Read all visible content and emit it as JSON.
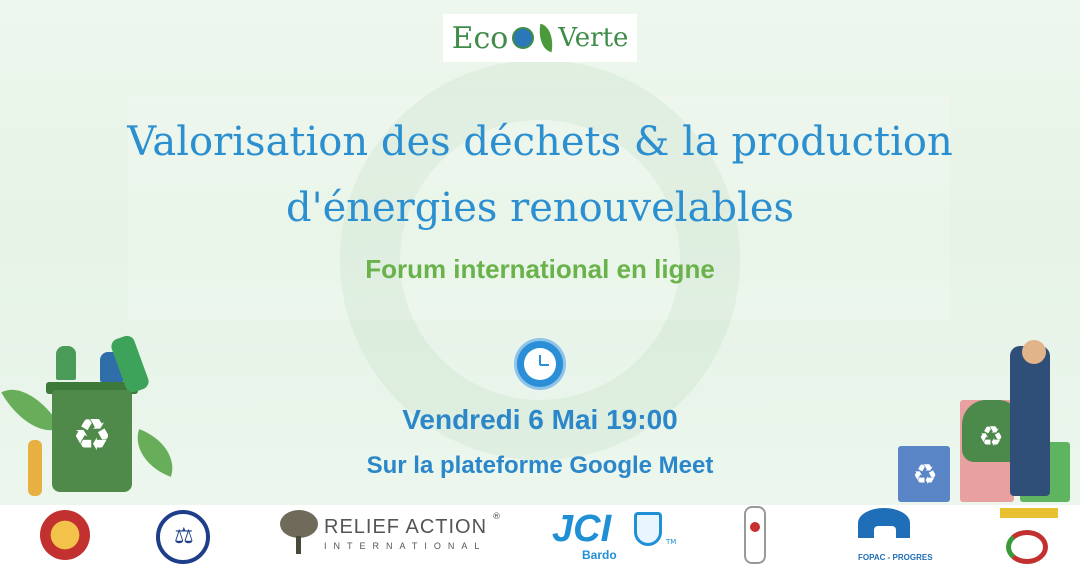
{
  "logo": {
    "brand_part1": "Eco",
    "brand_part2": "Verte",
    "icons": [
      "globe-icon",
      "leaf-icon"
    ]
  },
  "event": {
    "title_line1": "Valorisation des déchets & la production",
    "title_line2": "d'énergies renouvelables",
    "subtitle": "Forum international en ligne",
    "date_time": "Vendredi 6 Mai 19:00",
    "platform": "Sur la plateforme Google Meet"
  },
  "sponsors": {
    "relief_name": "RELIEF ACTION",
    "relief_reg": "®",
    "relief_sub": "INTERNATIONAL",
    "jci_name": "JCI",
    "jci_tm": "TM",
    "jci_sub": "Bardo",
    "fopac_label": "FOPAC - PROGRES"
  },
  "colors": {
    "title_blue": "#2b8fd0",
    "subtitle_green": "#6ab24a",
    "info_blue": "#2b87c9",
    "brand_green": "#3e8c48",
    "background": "#e8f4e8"
  }
}
